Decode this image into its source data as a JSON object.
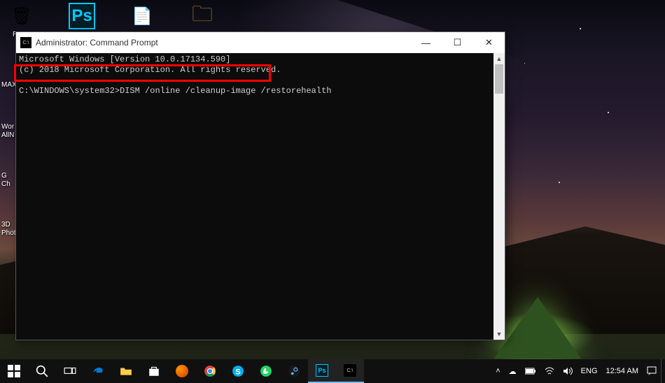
{
  "desktop": {
    "icons": [
      {
        "label": "Rec...",
        "name": "recycle-bin",
        "glyph": "🗑"
      },
      {
        "label": "",
        "name": "photoshop",
        "glyph": "Ps"
      },
      {
        "label": "",
        "name": "file",
        "glyph": "📄"
      },
      {
        "label": "",
        "name": "folder",
        "glyph": "🗀"
      }
    ],
    "side_labels": [
      "MAX",
      "Wor\nAllN",
      "G\nCh",
      "3D\nPhot"
    ]
  },
  "cmd": {
    "title": "Administrator: Command Prompt",
    "lines": {
      "l1": "Microsoft Windows [Version 10.0.17134.590]",
      "l2": "(c) 2018 Microsoft Corporation. All rights reserved.",
      "l3": "",
      "prompt": "C:\\WINDOWS\\system32>",
      "command": "DISM /online /cleanup-image /restorehealth"
    },
    "winbtn": {
      "min": "—",
      "max": "☐",
      "close": "✕"
    }
  },
  "taskbar": {
    "items": [
      "start",
      "search",
      "task-view",
      "edge",
      "file-explorer",
      "store",
      "firefox",
      "chrome",
      "skype",
      "whatsapp",
      "steam",
      "photoshop",
      "cmd"
    ],
    "systray": {
      "up": "˄",
      "onedrive": "☁",
      "battery": "🗲",
      "wifi": "📶",
      "volume": "🔊",
      "lang": "ENG",
      "time": "12:54 AM"
    }
  }
}
